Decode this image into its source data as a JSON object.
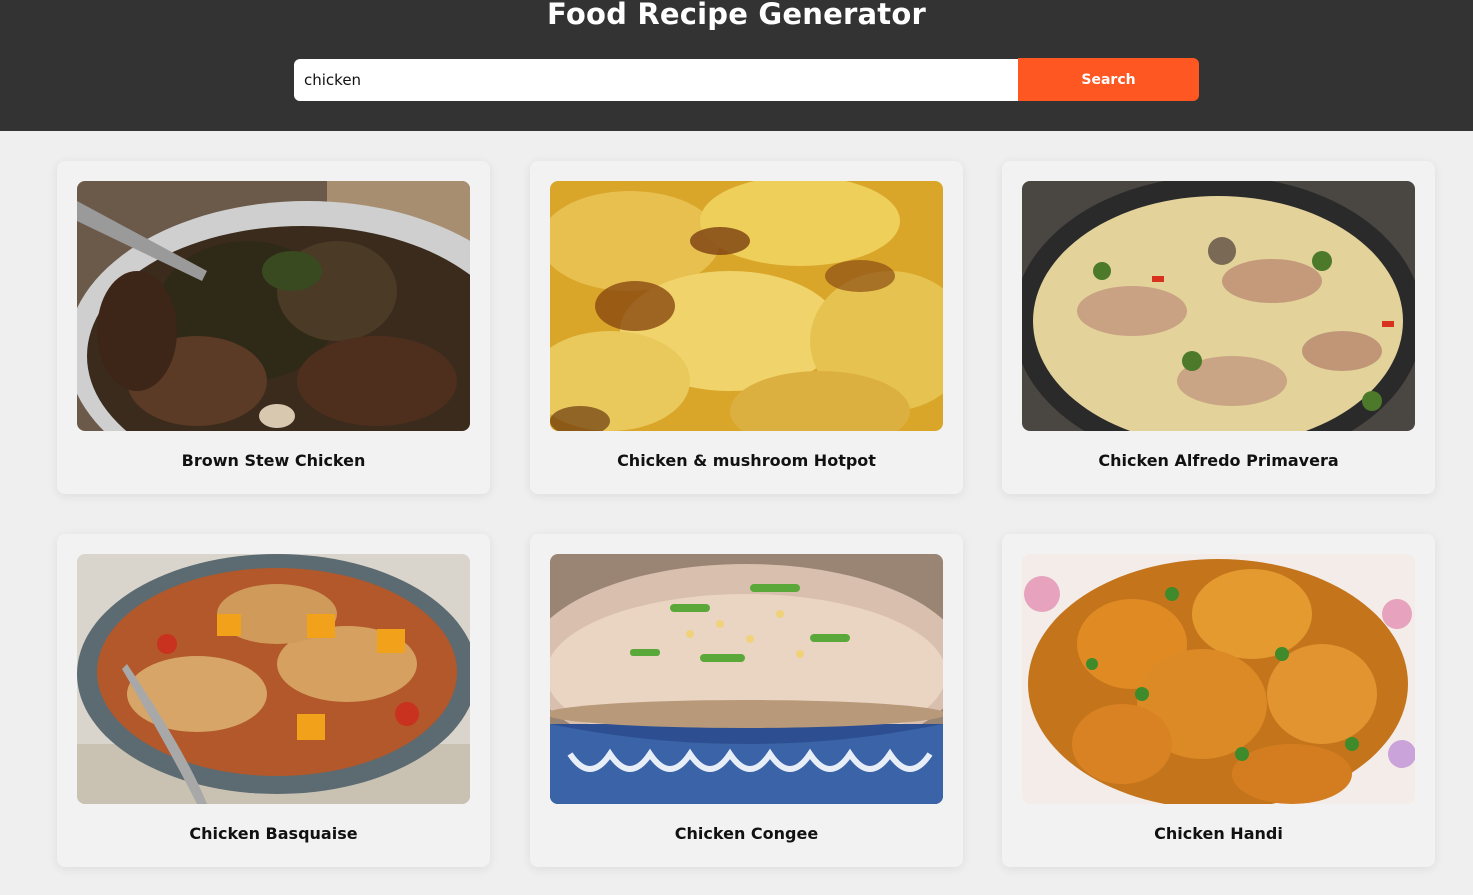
{
  "header": {
    "title": "Food Recipe Generator",
    "search_value": "chicken",
    "search_button_label": "Search"
  },
  "colors": {
    "header_bg": "#333333",
    "accent": "#ff5722",
    "page_bg": "#efefef"
  },
  "recipes": [
    {
      "title": "Brown Stew Chicken",
      "image": "brown-stew-chicken-photo"
    },
    {
      "title": "Chicken & mushroom Hotpot",
      "image": "chicken-mushroom-hotpot-photo"
    },
    {
      "title": "Chicken Alfredo Primavera",
      "image": "chicken-alfredo-primavera-photo"
    },
    {
      "title": "Chicken Basquaise",
      "image": "chicken-basquaise-photo"
    },
    {
      "title": "Chicken Congee",
      "image": "chicken-congee-photo"
    },
    {
      "title": "Chicken Handi",
      "image": "chicken-handi-photo"
    }
  ]
}
